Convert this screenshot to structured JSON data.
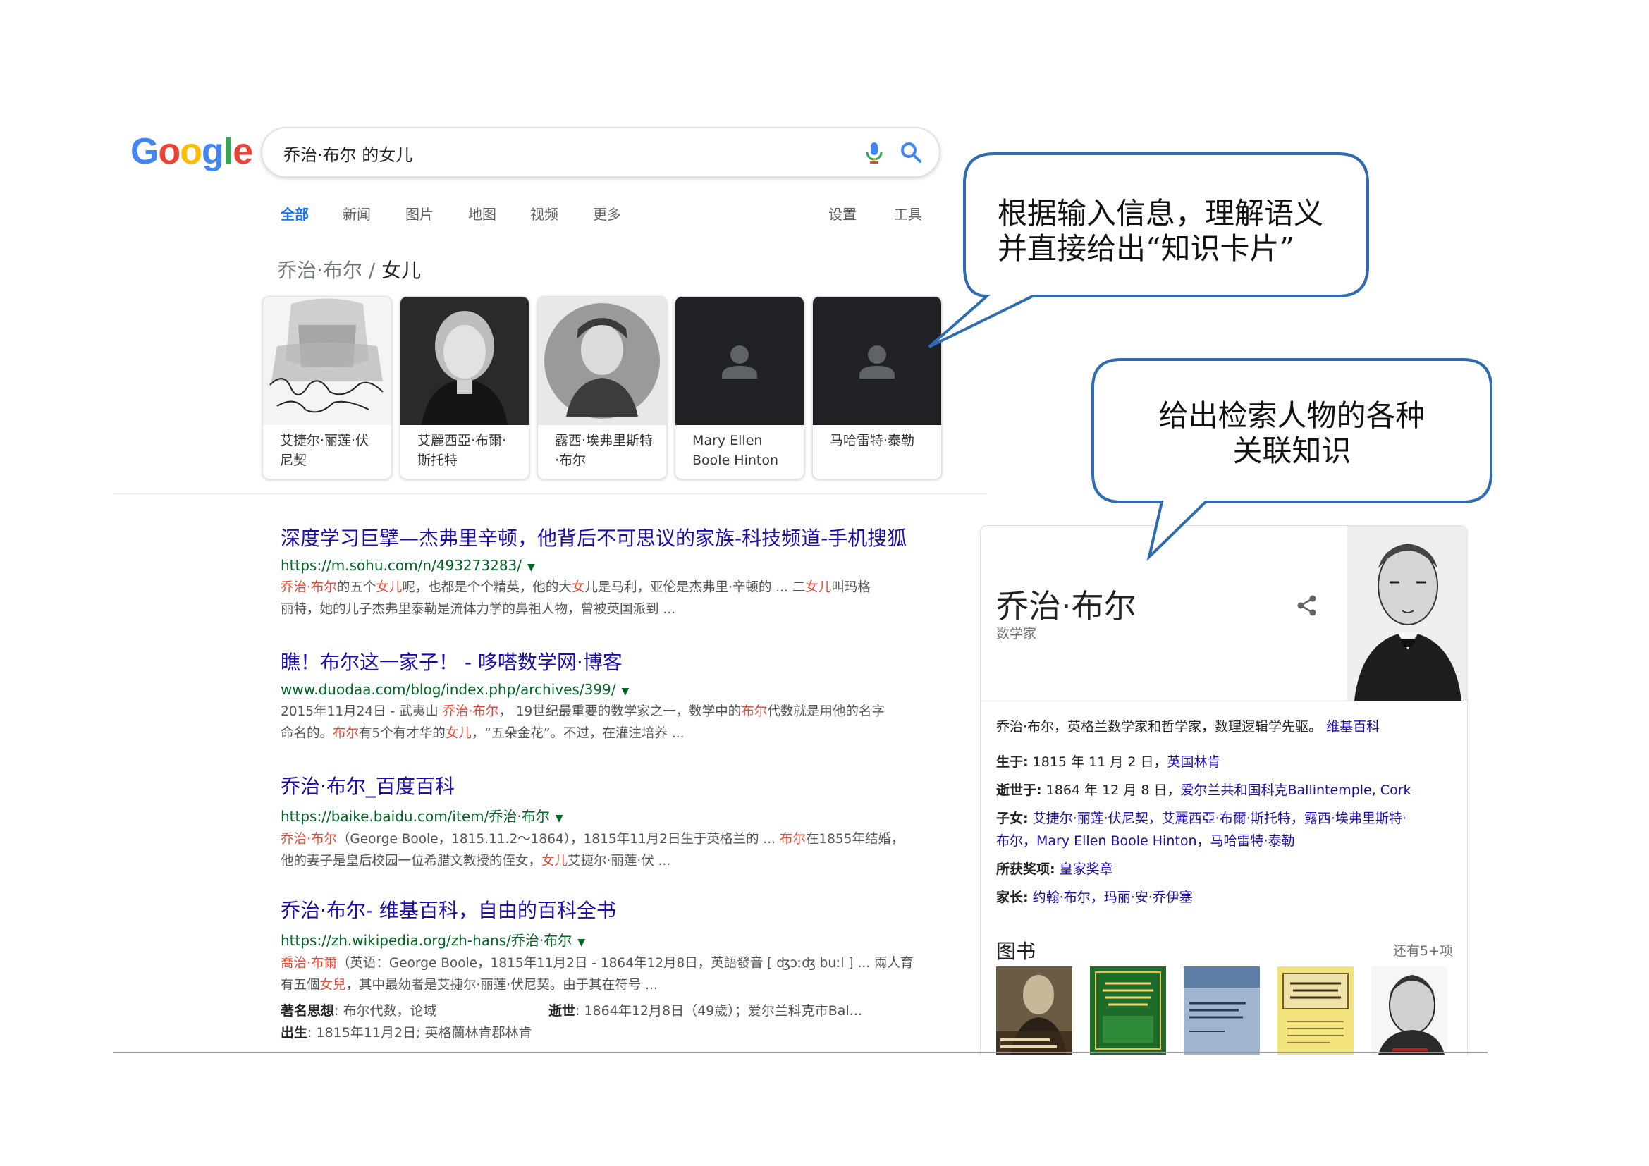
{
  "logo": {
    "letters": [
      "G",
      "o",
      "o",
      "g",
      "l",
      "e"
    ],
    "colors": [
      "#4285f4",
      "#ea4335",
      "#fbbc05",
      "#4285f4",
      "#34a853",
      "#ea4335"
    ]
  },
  "search": {
    "query": "乔治·布尔 的女儿"
  },
  "tabs": {
    "all": "全部",
    "news": "新闻",
    "images": "图片",
    "maps": "地图",
    "videos": "视频",
    "more": "更多",
    "settings": "设置",
    "tools": "工具"
  },
  "carousel": {
    "title_prefix": "乔治·布尔 / ",
    "title_topic": "女儿",
    "items": [
      {
        "name": "艾捷尔·丽莲·伏尼契"
      },
      {
        "name": "艾麗西亞·布爾·斯托特"
      },
      {
        "name": "露西·埃弗里斯特·布尔"
      },
      {
        "name": "Mary Ellen Boole Hinton"
      },
      {
        "name": "马哈雷特·泰勒"
      }
    ]
  },
  "results": [
    {
      "title": "深度学习巨擘—杰弗里辛顿，他背后不可思议的家族-科技频道-手机搜狐",
      "url": "https://m.sohu.com/n/493273283/",
      "snippet_lines": [
        [
          {
            "t": "乔治·布尔",
            "hl": true
          },
          {
            "t": "的五个"
          },
          {
            "t": "女儿",
            "hl": true
          },
          {
            "t": "呢，也都是个个精英，他的大"
          },
          {
            "t": "女",
            "hl": true
          },
          {
            "t": "儿是马利，亚伦是杰弗里·辛顿的 ... 二"
          },
          {
            "t": "女儿",
            "hl": true
          },
          {
            "t": "叫玛格"
          }
        ],
        [
          {
            "t": "丽特，她的儿子杰弗里泰勒是流体力学的鼻祖人物，曾被英国派到 ..."
          }
        ]
      ]
    },
    {
      "title": "瞧！布尔这一家子！ - 哆嗒数学网·博客",
      "url": "www.duodaa.com/blog/index.php/archives/399/",
      "snippet_lines": [
        [
          {
            "t": "2015年11月24日 - 武夷山 "
          },
          {
            "t": "乔治·布尔",
            "hl": true
          },
          {
            "t": "， 19世纪最重要的数学家之一，数学中的"
          },
          {
            "t": "布尔",
            "hl": true
          },
          {
            "t": "代数就是用他的名字"
          }
        ],
        [
          {
            "t": "命名的。"
          },
          {
            "t": "布尔",
            "hl": true
          },
          {
            "t": "有5个有才华的"
          },
          {
            "t": "女儿",
            "hl": true
          },
          {
            "t": "，“五朵金花”。不过，在灌注培养 ..."
          }
        ]
      ]
    },
    {
      "title": "乔治·布尔_百度百科",
      "url": "https://baike.baidu.com/item/乔治·布尔",
      "snippet_lines": [
        [
          {
            "t": "乔治·布尔",
            "hl": true
          },
          {
            "t": "（George Boole，1815.11.2～1864），1815年11月2日生于英格兰的 ... "
          },
          {
            "t": "布尔",
            "hl": true
          },
          {
            "t": "在1855年结婚，"
          }
        ],
        [
          {
            "t": "他的妻子是皇后校园一位希腊文教授的侄女，"
          },
          {
            "t": "女儿",
            "hl": true
          },
          {
            "t": "艾捷尔·丽莲·伏 ..."
          }
        ]
      ]
    },
    {
      "title": "乔治·布尔- 维基百科，自由的百科全书",
      "url": "https://zh.wikipedia.org/zh-hans/乔治·布尔",
      "snippet_lines": [
        [
          {
            "t": "喬治·布爾",
            "hl": true
          },
          {
            "t": "（英语：George Boole，1815年11月2日 - 1864年12月8日，英語發音 [ ʤɔːʤ buːl ] ... 兩人育"
          }
        ],
        [
          {
            "t": "有五個"
          },
          {
            "t": "女兒",
            "hl": true
          },
          {
            "t": "，其中最幼者是艾捷尔·丽莲·伏尼契。由于其在符号 ..."
          }
        ]
      ],
      "meta": {
        "thought_label": "著名思想",
        "thought": "布尔代数，论域",
        "death_label": "逝世",
        "death": "1864年12月8日（49歲）；爱尔兰科克市Bal...",
        "birth_label": "出生",
        "birth": "1815年11月2日; 英格蘭林肯郡林肯"
      }
    }
  ],
  "knowledge_panel": {
    "name": "乔治·布尔",
    "subtitle": "数学家",
    "description": "乔治·布尔，英格兰数学家和哲学家，数理逻辑学先驱。",
    "description_link": "维基百科",
    "born_label": "生于:",
    "born": "1815 年 11 月 2 日，",
    "born_link": "英国林肯",
    "died_label": "逝世于:",
    "died": "1864 年 12 月 8 日，",
    "died_link": "爱尔兰共和国科克Ballintemple, Cork",
    "children_label": "子女:",
    "children_line1": "艾捷尔·丽莲·伏尼契，艾麗西亞·布爾·斯托特，露西·埃弗里斯特·",
    "children_line2": "布尔，Mary Ellen Boole Hinton，马哈雷特·泰勒",
    "awards_label": "所获奖项:",
    "awards": "皇家奖章",
    "parents_label": "家长:",
    "parents": "约翰·布尔，玛丽·安·乔伊塞",
    "books_heading": "图书",
    "books_more": "还有5+项"
  },
  "callouts": {
    "top_line1": "根据输入信息，理解语义",
    "top_line2": "并直接给出“知识卡片”",
    "bottom_line1": "给出检索人物的各种",
    "bottom_line2": "关联知识",
    "border_color": "#2e6bb0"
  }
}
